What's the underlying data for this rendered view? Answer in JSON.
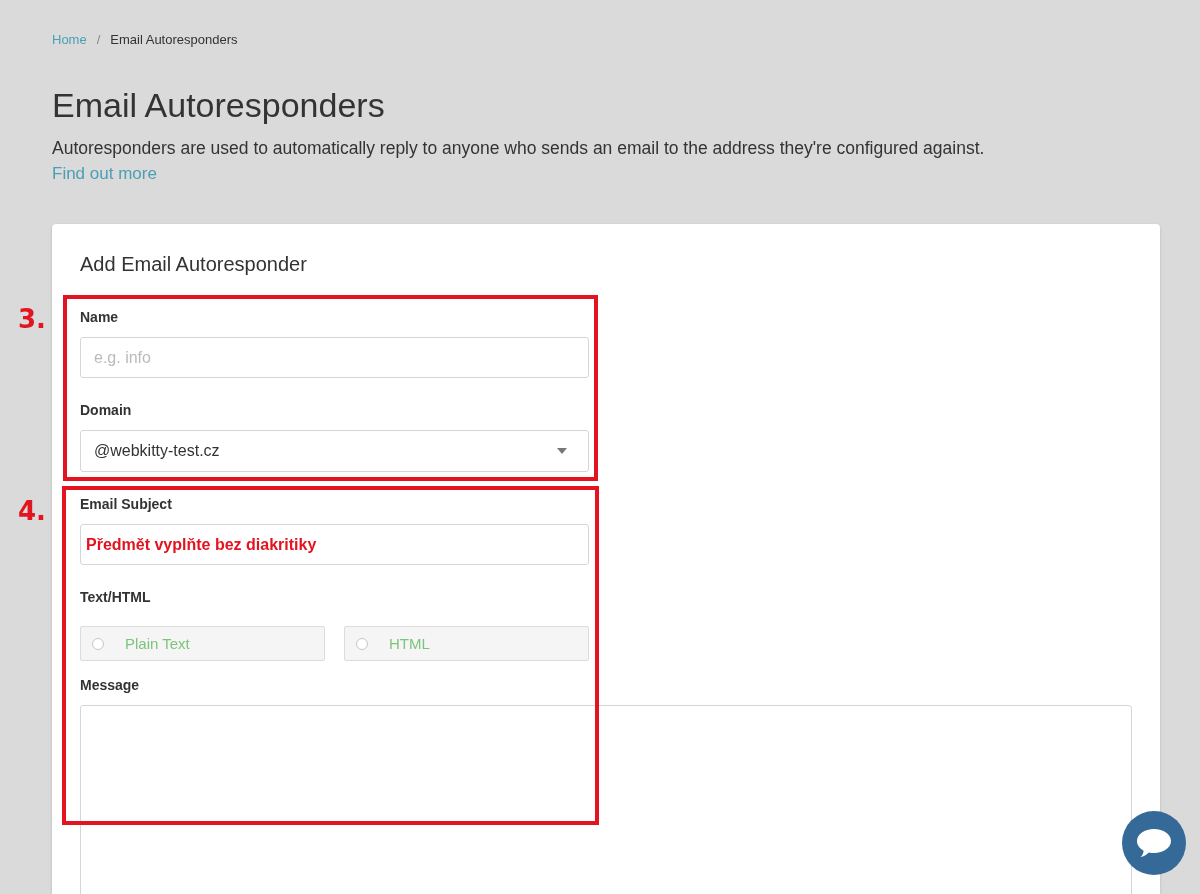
{
  "breadcrumb": {
    "separator": "/",
    "items": [
      {
        "label": "Home",
        "kind": "link"
      },
      {
        "label": "Email Autoresponders",
        "kind": "current"
      }
    ]
  },
  "header": {
    "title": "Email Autoresponders",
    "description": "Autoresponders are used to automatically reply to anyone who sends an email to the address they're configured against.",
    "link": "Find out more"
  },
  "form": {
    "title": "Add Email Autoresponder",
    "fields": [
      {
        "kind": "text",
        "label": "Name",
        "placeholder": "e.g. info",
        "highlighted": false
      },
      {
        "kind": "select",
        "label": "Domain",
        "value": "@webkitty-test.cz"
      },
      {
        "kind": "text",
        "label": "Email Subject",
        "value": "Předmět vyplňte bez diakritiky",
        "highlighted": true
      },
      {
        "kind": "radio",
        "label": "Text/HTML",
        "options": [
          {
            "label": "Plain Text",
            "selected": false
          },
          {
            "label": "HTML",
            "selected": false
          }
        ]
      },
      {
        "kind": "textarea",
        "label": "Message"
      }
    ]
  },
  "annotations": [
    {
      "label": "3."
    },
    {
      "label": "4."
    }
  ]
}
